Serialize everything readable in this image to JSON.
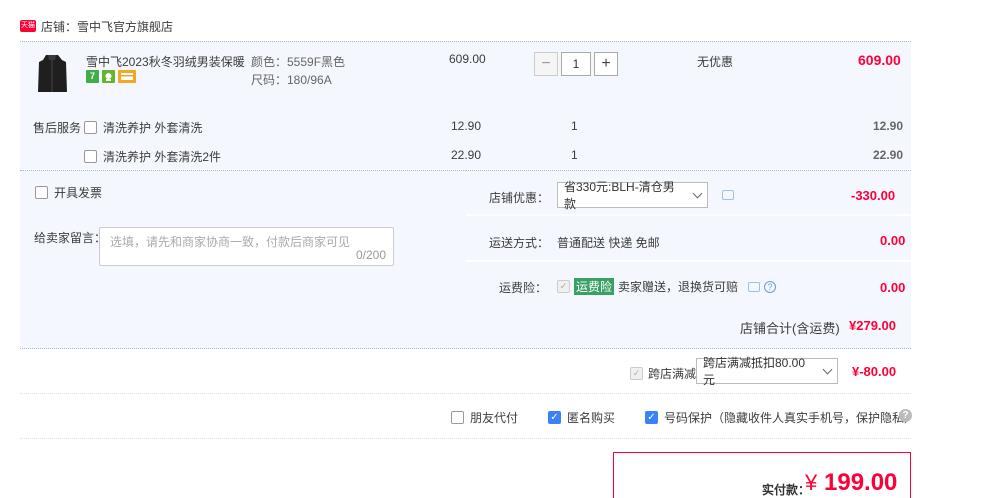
{
  "shop": {
    "label": "店铺：",
    "name": "雪中飞官方旗舰店",
    "icon": "tmall-icon"
  },
  "item": {
    "title": "雪中飞2023秋冬羽绒男装保暖...",
    "sku_color": "颜色：5559F黑色",
    "sku_size": "尺码：180/96A",
    "unit_price": "609.00",
    "quantity": "1",
    "discount": "无优惠",
    "subtotal": "609.00",
    "badges": [
      {
        "text": "7",
        "color": "#3fae49"
      },
      {
        "text": "",
        "color": "#67b430"
      },
      {
        "text": "",
        "color": "#f5a623"
      }
    ]
  },
  "after_sales": {
    "label": "售后服务",
    "options": [
      {
        "name": "清洗养护 外套清洗",
        "price": "12.90",
        "qty": "1",
        "total": "12.90"
      },
      {
        "name": "清洗养护 外套清洗2件",
        "price": "22.90",
        "qty": "1",
        "total": "22.90"
      }
    ]
  },
  "invoice": {
    "label": "开具发票"
  },
  "message": {
    "label": "给卖家留言：",
    "placeholder": "选填，请先和商家协商一致，付款后商家可见",
    "counter": "0/200"
  },
  "shop_coupon": {
    "label": "店铺优惠：",
    "selected": "省330元:BLH-清仓男款",
    "amount": "-330.00"
  },
  "shipping": {
    "label": "运送方式：",
    "method": "普通配送 快递 免邮",
    "amount": "0.00"
  },
  "insurance": {
    "label": "运费险：",
    "tag": "运费险",
    "desc": "卖家赠送，退换货可赔",
    "amount": "0.00"
  },
  "shop_total": {
    "label": "店铺合计(含运费)",
    "amount": "¥279.00"
  },
  "cross_shop": {
    "label": "跨店满减",
    "selected": "跨店满减抵扣80.00元",
    "amount": "¥-80.00"
  },
  "options": {
    "friend_pay": "朋友代付",
    "anonymous": "匿名购买",
    "number_protect": "号码保护（隐藏收件人真实手机号，保护隐私）"
  },
  "payment": {
    "label": "实付款：",
    "currency": "¥",
    "amount": "199.00"
  }
}
